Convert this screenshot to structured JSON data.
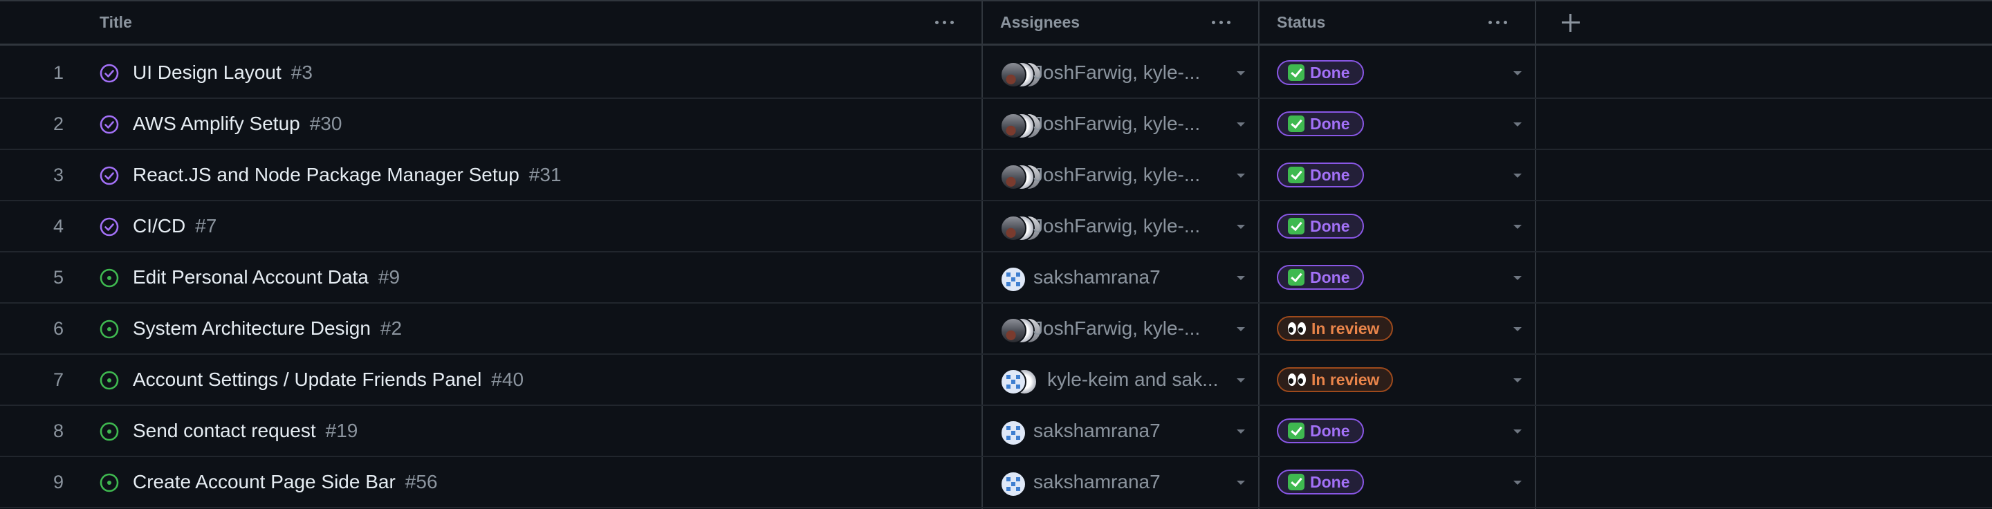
{
  "columns": {
    "title": "Title",
    "assignees": "Assignees",
    "status": "Status",
    "add_field_icon": "plus-icon",
    "menu_icon": "kebab-horizontal-icon"
  },
  "colors": {
    "closed_icon": "#a371f7",
    "open_icon": "#3fb950",
    "done": "#a371f7",
    "in_review": "#e8844a"
  },
  "rows": [
    {
      "num": "1",
      "state": "closed",
      "title": "UI Design Layout",
      "issue": "#3",
      "assignees": "JoshFarwig, kyle-...",
      "avatars": "group",
      "status": "Done"
    },
    {
      "num": "2",
      "state": "closed",
      "title": "AWS Amplify Setup",
      "issue": "#30",
      "assignees": "JoshFarwig, kyle-...",
      "avatars": "group",
      "status": "Done"
    },
    {
      "num": "3",
      "state": "closed",
      "title": "React.JS and Node Package Manager Setup",
      "issue": "#31",
      "assignees": "JoshFarwig, kyle-...",
      "avatars": "group",
      "status": "Done"
    },
    {
      "num": "4",
      "state": "closed",
      "title": "CI/CD",
      "issue": "#7",
      "assignees": "JoshFarwig, kyle-...",
      "avatars": "group",
      "status": "Done"
    },
    {
      "num": "5",
      "state": "open",
      "title": "Edit Personal Account Data",
      "issue": "#9",
      "assignees": "sakshamrana7",
      "avatars": "single",
      "status": "Done"
    },
    {
      "num": "6",
      "state": "open",
      "title": "System Architecture Design",
      "issue": "#2",
      "assignees": "JoshFarwig, kyle-...",
      "avatars": "group",
      "status": "In review"
    },
    {
      "num": "7",
      "state": "open",
      "title": "Account Settings / Update Friends Panel",
      "issue": "#40",
      "assignees": "kyle-keim and sak...",
      "avatars": "pair",
      "status": "In review"
    },
    {
      "num": "8",
      "state": "open",
      "title": "Send contact request",
      "issue": "#19",
      "assignees": "sakshamrana7",
      "avatars": "single",
      "status": "Done"
    },
    {
      "num": "9",
      "state": "open",
      "title": "Create Account Page Side Bar",
      "issue": "#56",
      "assignees": "sakshamrana7",
      "avatars": "single",
      "status": "Done"
    }
  ]
}
